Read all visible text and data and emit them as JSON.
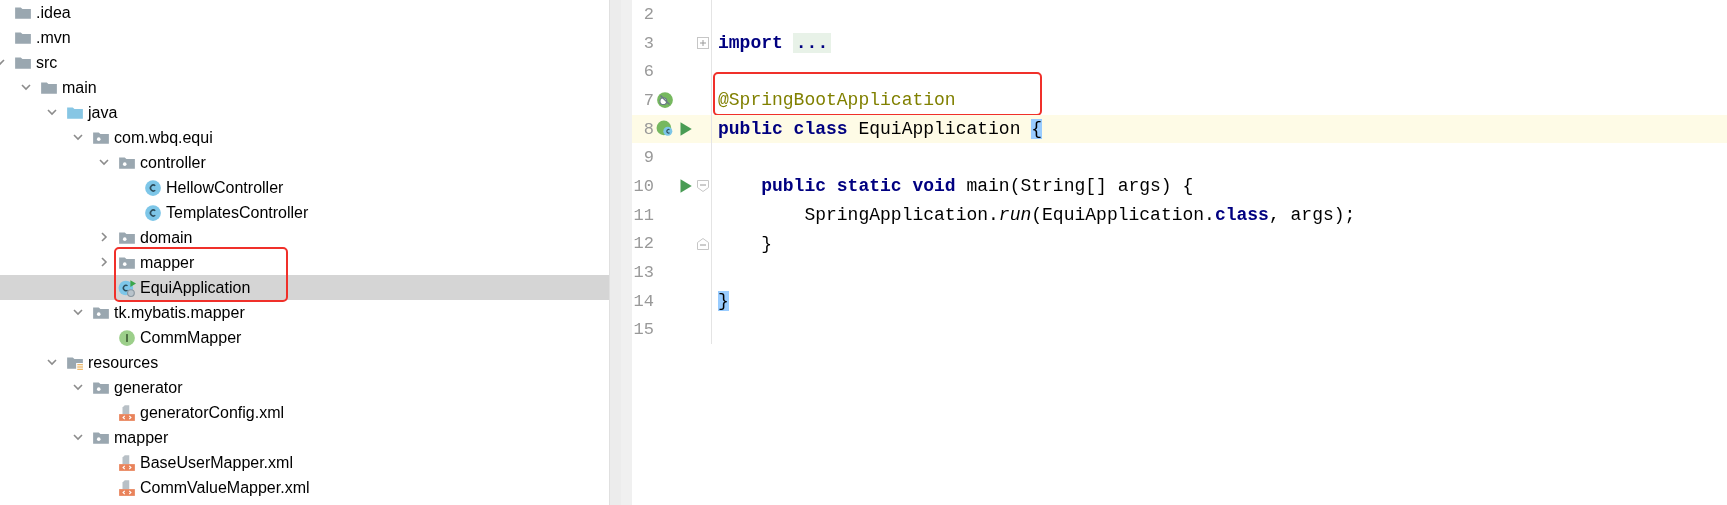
{
  "project_tree": {
    "items": [
      {
        "label": ".idea",
        "kind": "folder",
        "selected": false
      },
      {
        "label": ".mvn",
        "kind": "folder",
        "selected": false
      },
      {
        "label": "src",
        "kind": "folder",
        "selected": false,
        "expanded": true,
        "children": [
          {
            "label": "main",
            "kind": "folder",
            "selected": false,
            "expanded": true,
            "children": [
              {
                "label": "java",
                "kind": "source-folder",
                "selected": false,
                "expanded": true,
                "children": [
                  {
                    "label": "com.wbq.equi",
                    "kind": "package",
                    "selected": false,
                    "expanded": true,
                    "children": [
                      {
                        "label": "controller",
                        "kind": "package",
                        "selected": false,
                        "expanded": true,
                        "children": [
                          {
                            "label": "HellowController",
                            "kind": "class",
                            "selected": false
                          },
                          {
                            "label": "TemplatesController",
                            "kind": "class",
                            "selected": false
                          }
                        ]
                      },
                      {
                        "label": "domain",
                        "kind": "package",
                        "selected": false,
                        "expanded": false
                      },
                      {
                        "label": "mapper",
                        "kind": "package",
                        "selected": false,
                        "expanded": false,
                        "boxed": true
                      },
                      {
                        "label": "EquiApplication",
                        "kind": "spring-class",
                        "selected": true,
                        "boxed": true
                      }
                    ]
                  },
                  {
                    "label": "tk.mybatis.mapper",
                    "kind": "package",
                    "selected": false,
                    "expanded": true,
                    "children": [
                      {
                        "label": "CommMapper",
                        "kind": "interface",
                        "selected": false
                      }
                    ]
                  }
                ]
              },
              {
                "label": "resources",
                "kind": "resources-folder",
                "selected": false,
                "expanded": true,
                "children": [
                  {
                    "label": "generator",
                    "kind": "package",
                    "selected": false,
                    "expanded": true,
                    "children": [
                      {
                        "label": "generatorConfig.xml",
                        "kind": "xml",
                        "selected": false
                      }
                    ]
                  },
                  {
                    "label": "mapper",
                    "kind": "package",
                    "selected": false,
                    "expanded": true,
                    "children": [
                      {
                        "label": "BaseUserMapper.xml",
                        "kind": "xml",
                        "selected": false
                      },
                      {
                        "label": "CommValueMapper.xml",
                        "kind": "xml",
                        "selected": false
                      }
                    ]
                  }
                ]
              }
            ]
          }
        ]
      }
    ]
  },
  "editor": {
    "lines": [
      {
        "number": "2",
        "current": false
      },
      {
        "number": "3",
        "current": false,
        "fold": {
          "kind": "collapsed"
        },
        "tokens": [
          {
            "text": "import",
            "kind": "keyword"
          },
          {
            "text": "...",
            "kind": "folded"
          }
        ]
      },
      {
        "number": "6",
        "current": false
      },
      {
        "number": "7",
        "current": false,
        "boxed": true,
        "gutter": [
          {
            "kind": "bean"
          }
        ],
        "tokens": [
          {
            "text": "@SpringBootApplication",
            "kind": "annotation"
          }
        ]
      },
      {
        "number": "8",
        "current": true,
        "gutter": [
          {
            "kind": "bean-class"
          },
          {
            "kind": "run"
          }
        ],
        "tokens": [
          {
            "text": "public class",
            "kind": "keyword"
          },
          {
            "text": " EquiApplication ",
            "kind": "plain"
          },
          {
            "text": "{",
            "kind": "brace-match"
          }
        ]
      },
      {
        "number": "9",
        "current": false
      },
      {
        "number": "10",
        "current": false,
        "fold": {
          "kind": "open"
        },
        "gutter": [
          {
            "kind": "run"
          }
        ],
        "tokens": [
          {
            "text": "    public static void",
            "kind": "keyword"
          },
          {
            "text": " main(String[] args) {",
            "kind": "plain"
          }
        ]
      },
      {
        "number": "11",
        "current": false,
        "tokens": [
          {
            "text": "        SpringApplication.",
            "kind": "plain"
          },
          {
            "text": "run",
            "kind": "italic"
          },
          {
            "text": "(EquiApplication.",
            "kind": "plain"
          },
          {
            "text": "class",
            "kind": "keyword"
          },
          {
            "text": ", args);",
            "kind": "plain"
          }
        ]
      },
      {
        "number": "12",
        "current": false,
        "fold": {
          "kind": "close"
        },
        "tokens": [
          {
            "text": "    }",
            "kind": "plain"
          }
        ]
      },
      {
        "number": "13",
        "current": false
      },
      {
        "number": "14",
        "current": false,
        "tokens": [
          {
            "text": "}",
            "kind": "brace-match"
          }
        ]
      },
      {
        "number": "15",
        "current": false
      }
    ]
  }
}
